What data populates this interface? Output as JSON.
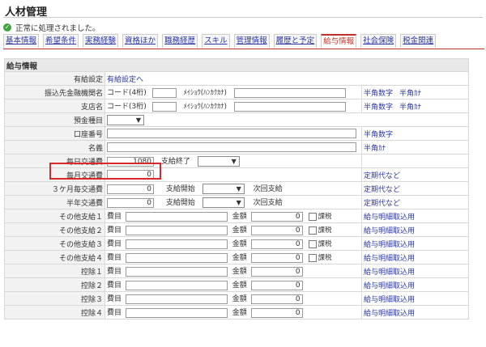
{
  "page": {
    "title": "人材管理",
    "status_message": "正常に処理されました。"
  },
  "tabs": [
    {
      "label": "基本情報",
      "active": false
    },
    {
      "label": "希望条件",
      "active": false
    },
    {
      "label": "実務経験",
      "active": false
    },
    {
      "label": "資格ほか",
      "active": false
    },
    {
      "label": "職務経歴",
      "active": false
    },
    {
      "label": "スキル",
      "active": false
    },
    {
      "label": "管理情報",
      "active": false
    },
    {
      "label": "履歴と予定",
      "active": false
    },
    {
      "label": "給与情報",
      "active": true
    },
    {
      "label": "社会保険",
      "active": false
    },
    {
      "label": "税金関連",
      "active": false
    }
  ],
  "section": {
    "title": "給与情報"
  },
  "rows": {
    "yukyu": {
      "label": "有給設定",
      "link": "有給設定へ"
    },
    "bank": {
      "label": "振込先金融機関名",
      "code_label": "コード(4桁)",
      "kana_label": "ﾒｲｼｮｳ(ﾊﾝｶｸｶﾅ)",
      "note1": "半角数字",
      "note2": "半角ｶﾅ"
    },
    "branch": {
      "label": "支店名",
      "code_label": "コード(3桁)",
      "kana_label": "ﾒｲｼｮｳ(ﾊﾝｶｸｶﾅ)",
      "note1": "半角数字",
      "note2": "半角ｶﾅ"
    },
    "account_type": {
      "label": "預金種目"
    },
    "account_no": {
      "label": "口座番号",
      "note": "半角数字"
    },
    "holder": {
      "label": "名義",
      "note": "半角ｶﾅ"
    },
    "daily": {
      "label": "毎日交通費",
      "value": "1080",
      "after": "支給終了"
    },
    "monthly": {
      "label": "毎月交通費",
      "value": "0",
      "note": "定期代など"
    },
    "quarterly": {
      "label": "３ケ月毎交通費",
      "value": "0",
      "start": "支給開始",
      "next": "次回支給",
      "note": "定期代など"
    },
    "half": {
      "label": "半年交通費",
      "value": "0",
      "start": "支給開始",
      "next": "次回支給",
      "note": "定期代など"
    }
  },
  "other": [
    {
      "label": "その他支給１",
      "hi": "費目",
      "kin": "金額",
      "value": "0",
      "tax": "課税",
      "note": "給与明細取込用"
    },
    {
      "label": "その他支給２",
      "hi": "費目",
      "kin": "金額",
      "value": "0",
      "tax": "課税",
      "note": "給与明細取込用"
    },
    {
      "label": "その他支給３",
      "hi": "費目",
      "kin": "金額",
      "value": "0",
      "tax": "課税",
      "note": "給与明細取込用"
    },
    {
      "label": "その他支給４",
      "hi": "費目",
      "kin": "金額",
      "value": "0",
      "tax": "課税",
      "note": "給与明細取込用"
    }
  ],
  "deduct": [
    {
      "label": "控除１",
      "hi": "費目",
      "kin": "金額",
      "value": "0",
      "note": "給与明細取込用"
    },
    {
      "label": "控除２",
      "hi": "費目",
      "kin": "金額",
      "value": "0",
      "note": "給与明細取込用"
    },
    {
      "label": "控除３",
      "hi": "費目",
      "kin": "金額",
      "value": "0",
      "note": "給与明細取込用"
    },
    {
      "label": "控除４",
      "hi": "費目",
      "kin": "金額",
      "value": "0",
      "note": "給与明細取込用"
    }
  ],
  "icons": {
    "status": "check-circle-icon",
    "dropdown": "chevron-down-icon"
  },
  "colors": {
    "accent": "#c0302a",
    "link": "#2a37a8",
    "highlight": "#d8282c",
    "ok": "#3fa23f"
  }
}
